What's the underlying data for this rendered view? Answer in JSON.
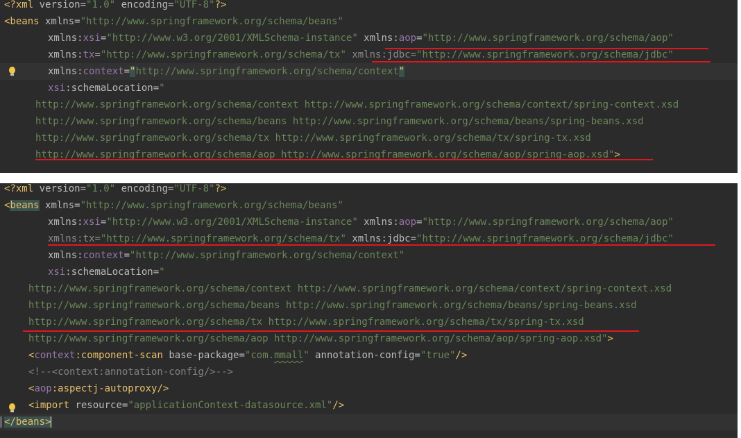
{
  "top_panel": {
    "lines": [
      {
        "decl_open": "<?xml",
        "v_attr": " version=",
        "v_val": "\"1.0\"",
        "e_attr": " encoding=",
        "e_val": "\"UTF-8\"",
        "decl_close": "?>"
      },
      {
        "tag": "<beans",
        "a1": " xmlns=",
        "v1": "\"http://www.springframework.org/schema/beans\""
      },
      {
        "p": "xmlns:",
        "ns": "xsi",
        "eq": "=",
        "v": "\"http://www.w3.org/2001/XMLSchema-instance\"",
        "p2": " xmlns:",
        "ns2": "aop",
        "eq2": "=",
        "v2": "\"http://www.springframework.org/schema/aop\""
      },
      {
        "p": "xmlns:",
        "ns": "tx",
        "eq": "=",
        "v": "\"http://www.springframework.org/schema/tx\"",
        "p2": " xmlns:jdbc=",
        "v2": "\"http://www.springframework.org/schema/jdbc\""
      },
      {
        "p": "xmlns:",
        "ns": "context",
        "eq": "=",
        "q": "\"",
        "v": "http://www.springframework.org/schema/context",
        "q2": "\""
      },
      {
        "ns": "xsi",
        "p": ":schemaLocation=",
        "v": "\""
      },
      {
        "v": "http://www.springframework.org/schema/context http://www.springframework.org/schema/context/spring-context.xsd"
      },
      {
        "v": "http://www.springframework.org/schema/beans http://www.springframework.org/schema/beans/spring-beans.xsd"
      },
      {
        "v": "http://www.springframework.org/schema/tx http://www.springframework.org/schema/tx/spring-tx.xsd"
      },
      {
        "v": "http://www.springframework.org/schema/aop http://www.springframework.org/schema/aop/spring-aop.xsd\"",
        "close": ">"
      }
    ]
  },
  "bottom_panel": {
    "lines": [
      {
        "decl_open": "<?xml",
        "v_attr": " version=",
        "v_val": "\"1.0\"",
        "e_attr": " encoding=",
        "e_val": "\"UTF-8\"",
        "decl_close": "?>"
      },
      {
        "tag_lt": "<",
        "tag": "beans",
        "a1": " xmlns=",
        "v1": "\"http://www.springframework.org/schema/beans\""
      },
      {
        "p": "xmlns:",
        "ns": "xsi",
        "eq": "=",
        "v": "\"http://www.w3.org/2001/XMLSchema-instance\"",
        "p2": " xmlns:",
        "ns2": "aop",
        "eq2": "=",
        "v2": "\"http://www.springframework.org/schema/aop\""
      },
      {
        "p": "xmlns:",
        "ns": "tx",
        "eq": "=",
        "v": "\"http://www.springframework.org/schema/tx\"",
        "p2": " xmlns:jdbc=",
        "v2": "\"http://www.springframework.org/schema/jdbc\""
      },
      {
        "p": "xmlns:",
        "ns": "context",
        "eq": "=",
        "v": "\"http://www.springframework.org/schema/context\""
      },
      {
        "ns": "xsi",
        "p": ":schemaLocation=",
        "v": "\""
      },
      {
        "v": "http://www.springframework.org/schema/context http://www.springframework.org/schema/context/spring-context.xsd"
      },
      {
        "v": "http://www.springframework.org/schema/beans http://www.springframework.org/schema/beans/spring-beans.xsd"
      },
      {
        "v": "http://www.springframework.org/schema/tx http://www.springframework.org/schema/tx/spring-tx.xsd"
      },
      {
        "v": "http://www.springframework.org/schema/aop http://www.springframework.org/schema/aop/spring-aop.xsd\"",
        "close": ">"
      },
      {
        "lt": "<",
        "ns": "context",
        "tag": ":component-scan",
        "a1": " base-package=",
        "q": "\"com.",
        "tilde": "mmall",
        "q2": "\"",
        "a2": " annotation-config=",
        "v2": "\"true\"",
        "close": "/>"
      },
      {
        "cmt": "<!--<context:annotation-config/>-->"
      },
      {
        "lt": "<",
        "ns": "aop",
        "tag": ":aspectj-autoproxy",
        "close": "/>"
      },
      {
        "tag": "<import",
        "a1": " resource=",
        "v1": "\"applicationContext-datasource.xml\"",
        "close": "/>"
      },
      {
        "tag": "</beans>"
      }
    ]
  },
  "colors": {
    "editor_bg": "#2b2b2b",
    "tag": "#e8bf6a",
    "attribute": "#bababa",
    "namespace": "#9876aa",
    "string": "#6a8759",
    "comment": "#808080",
    "annotation_underline": "#e1161e"
  },
  "icons": [
    "intention-bulb-icon"
  ]
}
